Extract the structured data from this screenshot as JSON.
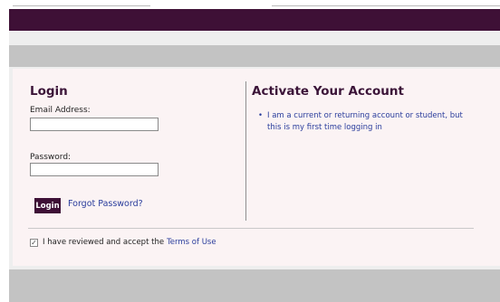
{
  "login": {
    "title": "Login",
    "email_label": "Email Address:",
    "email_value": "",
    "password_label": "Password:",
    "password_value": "",
    "login_button": "Login",
    "forgot_link": "Forgot Password?"
  },
  "activate": {
    "title": "Activate Your Account",
    "items": [
      {
        "label": "I am a current or returning account or student, but this is my first time logging in"
      }
    ]
  },
  "terms": {
    "checked": true,
    "text": "I have reviewed and accept the",
    "link": "Terms of Use"
  },
  "colors": {
    "banner": "#3e1036",
    "panel": "#fbf3f4",
    "link": "#2a3d9c",
    "band": "#c3c3c3"
  },
  "icons": {
    "bullet": "bullet-icon",
    "checkbox": "checkbox-icon"
  }
}
